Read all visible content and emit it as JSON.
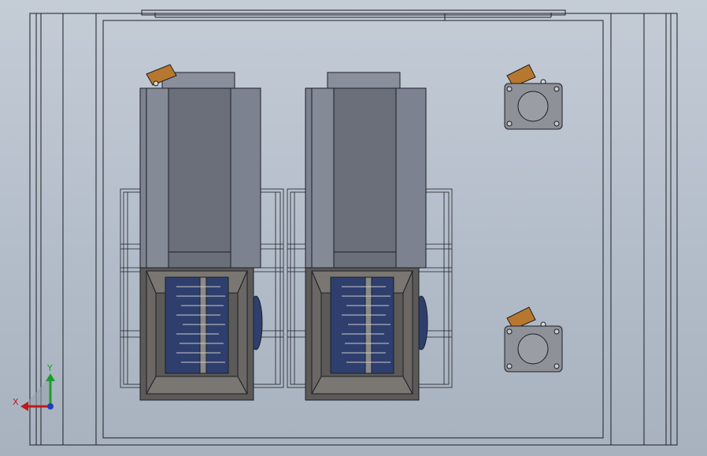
{
  "viewport": {
    "background_top": "#c4ccd6",
    "background_bottom": "#a8b2bf",
    "line_color": "#1c1f24"
  },
  "model": {
    "frame_color": "#3b3f45",
    "cartridge_color": "#6a6f7a",
    "cartridge_side_color": "#7d8290",
    "cartridge_face_color": "#8a8f9c",
    "hopper_color": "#5c5a58",
    "hopper_inner_color": "#7a7672",
    "roller_color": "#2e3f6e",
    "blade_color": "#8a8a8a",
    "motor_body_color": "#8e9198",
    "motor_handle_color": "#b8772e",
    "cartridge_count": 2,
    "motor_count": 2
  },
  "triad": {
    "x_label": "X",
    "y_label": "Y",
    "x_color": "#c0181c",
    "y_color": "#1a9e2a",
    "z_color": "#1f3fb8"
  }
}
